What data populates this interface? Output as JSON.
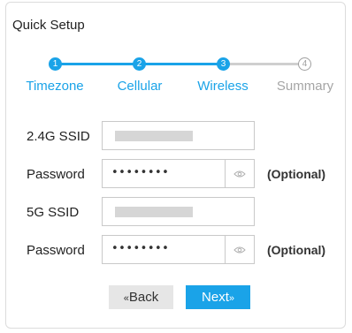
{
  "title": "Quick Setup",
  "steps": [
    {
      "number": "1",
      "label": "Timezone",
      "state": "done"
    },
    {
      "number": "2",
      "label": "Cellular",
      "state": "done"
    },
    {
      "number": "3",
      "label": "Wireless",
      "state": "current"
    },
    {
      "number": "4",
      "label": "Summary",
      "state": "pending"
    }
  ],
  "fields": {
    "ssid_24": {
      "label": "2.4G SSID"
    },
    "password_24": {
      "label": "Password",
      "value": "••••••••",
      "note": "(Optional)"
    },
    "ssid_5": {
      "label": "5G SSID"
    },
    "password_5": {
      "label": "Password",
      "value": "••••••••",
      "note": "(Optional)"
    }
  },
  "buttons": {
    "back_arrow": "«",
    "back": "Back",
    "next": "Next",
    "next_arrow": "»"
  },
  "colors": {
    "accent": "#1aa3e8",
    "inactive": "#a5a5a5"
  },
  "icons": {
    "show_password": "eye-icon"
  }
}
